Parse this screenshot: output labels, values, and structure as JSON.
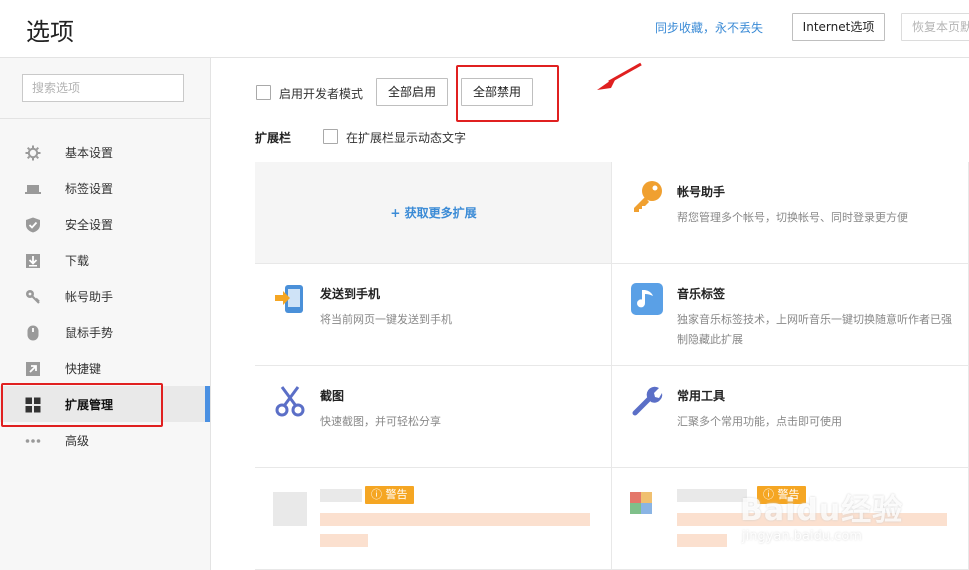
{
  "header": {
    "title": "选项",
    "sync_link": "同步收藏，永不丢失",
    "internet_button": "Internet选项",
    "restore_button": "恢复本页默"
  },
  "sidebar": {
    "search_placeholder": "搜索选项",
    "items": [
      {
        "label": "基本设置",
        "icon": "gear-icon"
      },
      {
        "label": "标签设置",
        "icon": "tab-icon"
      },
      {
        "label": "安全设置",
        "icon": "shield-icon"
      },
      {
        "label": "下载",
        "icon": "download-icon"
      },
      {
        "label": "帐号助手",
        "icon": "key-icon"
      },
      {
        "label": "鼠标手势",
        "icon": "mouse-icon"
      },
      {
        "label": "快捷键",
        "icon": "shortcut-icon"
      },
      {
        "label": "扩展管理",
        "icon": "grid-icon",
        "active": true
      },
      {
        "label": "高级",
        "icon": "more-icon"
      }
    ]
  },
  "main": {
    "dev_mode_label": "启用开发者模式",
    "enable_all_button": "全部启用",
    "disable_all_button": "全部禁用",
    "ext_bar_label": "扩展栏",
    "show_dynamic_text_label": "在扩展栏显示动态文字",
    "get_more_label": "+ 获取更多扩展",
    "extensions": [
      {
        "name": "帐号助手",
        "desc": "帮您管理多个帐号，切换帐号、同时登录更方便",
        "icon": "key-icon"
      },
      {
        "name": "发送到手机",
        "desc": "将当前网页一键发送到手机",
        "icon": "phone-send-icon"
      },
      {
        "name": "音乐标签",
        "desc": "独家音乐标签技术，上网听音乐一键切换随意听作者已强制隐藏此扩展",
        "icon": "music-icon"
      },
      {
        "name": "截图",
        "desc": "快速截图，并可轻松分享",
        "icon": "scissors-icon"
      },
      {
        "name": "常用工具",
        "desc": "汇聚多个常用功能，点击即可使用",
        "icon": "wrench-icon"
      }
    ],
    "warning_label": "警告",
    "watermark": {
      "main": "Baidu经验",
      "sub": "jingyan.baidu.com"
    }
  },
  "colors": {
    "accent": "#4a90e2",
    "link": "#3b8bd6",
    "highlight": "#e02020",
    "warning": "#f5a623"
  }
}
